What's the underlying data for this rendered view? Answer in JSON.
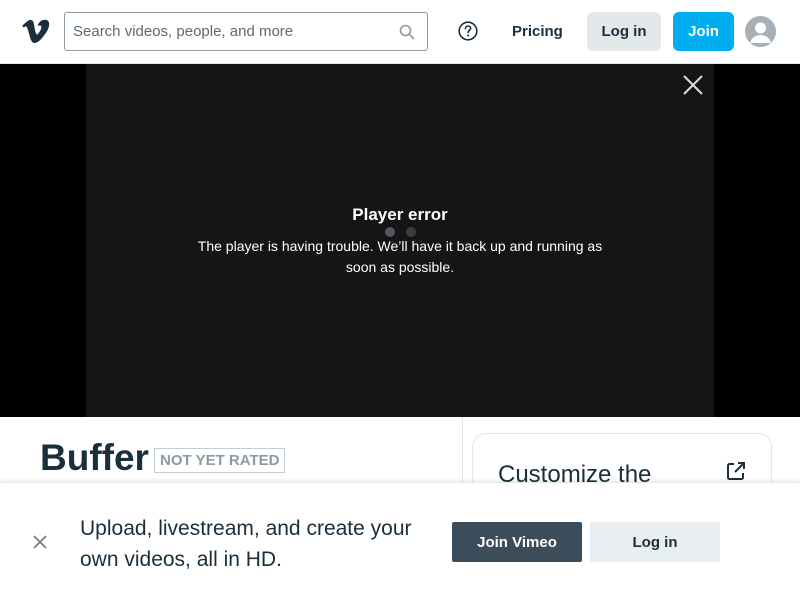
{
  "header": {
    "logo_icon": "vimeo-logo-icon",
    "search_placeholder": "Search videos, people, and more",
    "search_icon": "search-icon",
    "help_icon": "help-icon",
    "pricing_label": "Pricing",
    "login_label": "Log in",
    "join_label": "Join",
    "avatar_icon": "user-avatar-icon"
  },
  "player": {
    "close_icon": "close-icon",
    "error_title": "Player error",
    "error_message": "The player is having trouble. We’ll have it back up and running as soon as possible."
  },
  "video": {
    "title": "Buffer",
    "rating": "NOT YET RATED"
  },
  "sidebar": {
    "card_title": "Customize the",
    "external_icon": "external-link-icon"
  },
  "banner": {
    "close_icon": "close-icon",
    "message": "Upload, livestream, and create your own videos, all in HD.",
    "join_label": "Join Vimeo",
    "login_label": "Log in"
  },
  "colors": {
    "brand_blue": "#00adef",
    "text_dark": "#1a2e3b",
    "button_dark": "#3b4d5b",
    "button_light": "#e3e8e9"
  }
}
